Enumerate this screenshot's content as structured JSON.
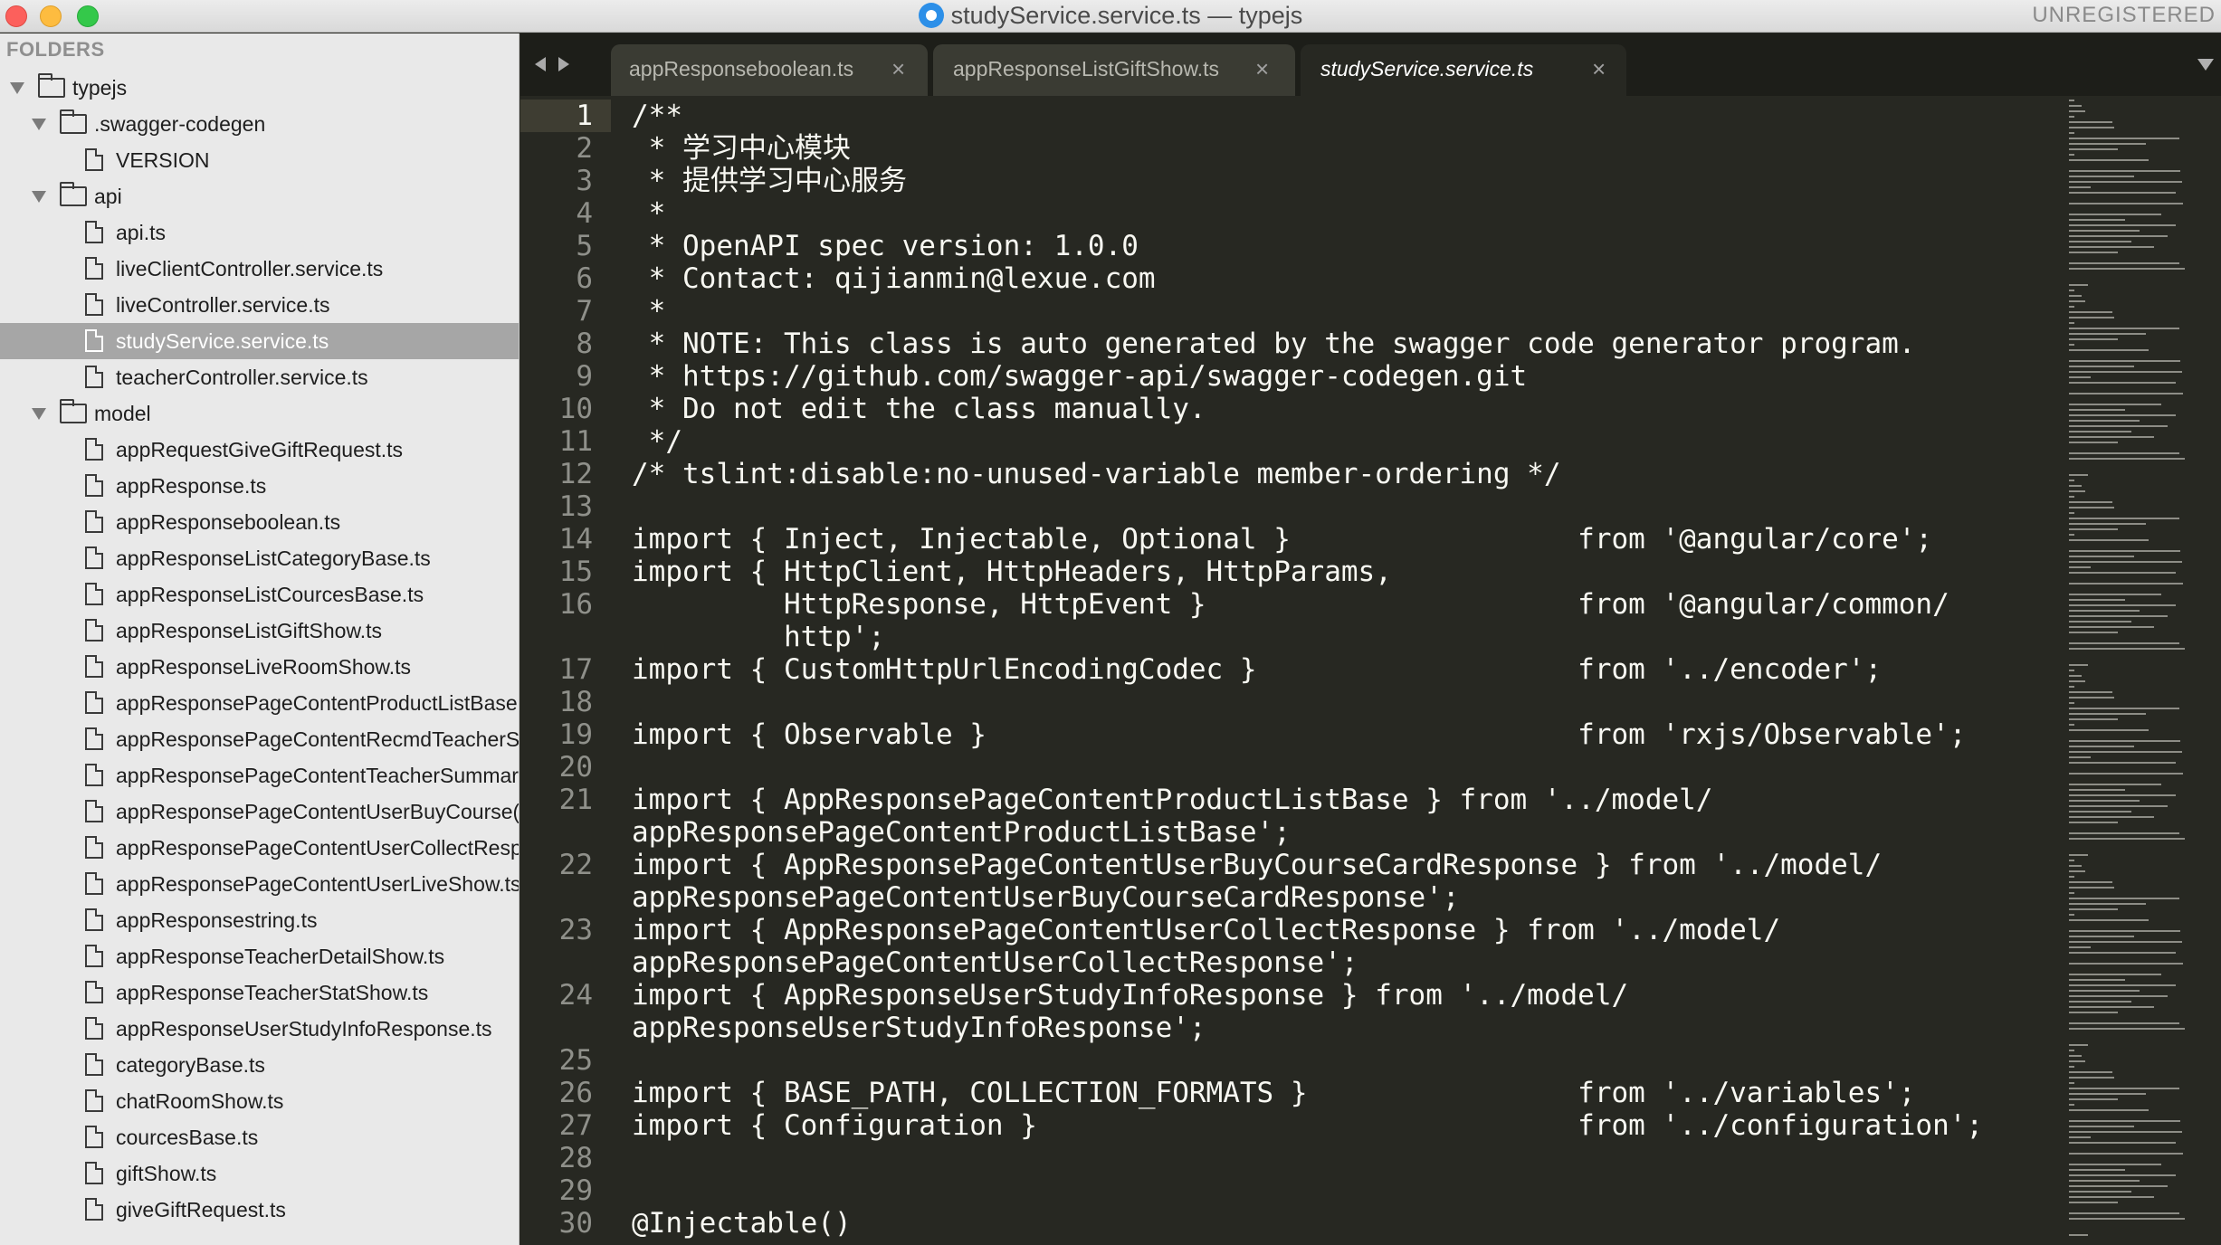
{
  "window": {
    "title": "studyService.service.ts — typejs",
    "unregistered": "UNREGISTERED"
  },
  "sidebar": {
    "header": "FOLDERS",
    "root": "typejs",
    "swagger_folder": ".swagger-codegen",
    "version_file": "VERSION",
    "api_folder": "api",
    "api_files": [
      "api.ts",
      "liveClientController.service.ts",
      "liveController.service.ts",
      "studyService.service.ts",
      "teacherController.service.ts"
    ],
    "model_folder": "model",
    "model_files": [
      "appRequestGiveGiftRequest.ts",
      "appResponse.ts",
      "appResponseboolean.ts",
      "appResponseListCategoryBase.ts",
      "appResponseListCourcesBase.ts",
      "appResponseListGiftShow.ts",
      "appResponseLiveRoomShow.ts",
      "appResponsePageContentProductListBase",
      "appResponsePageContentRecmdTeacherS",
      "appResponsePageContentTeacherSummar",
      "appResponsePageContentUserBuyCourse(",
      "appResponsePageContentUserCollectResp",
      "appResponsePageContentUserLiveShow.ts",
      "appResponsestring.ts",
      "appResponseTeacherDetailShow.ts",
      "appResponseTeacherStatShow.ts",
      "appResponseUserStudyInfoResponse.ts",
      "categoryBase.ts",
      "chatRoomShow.ts",
      "courcesBase.ts",
      "giftShow.ts",
      "giveGiftRequest.ts"
    ]
  },
  "tabs": [
    {
      "label": "appResponseboolean.ts",
      "close": "×"
    },
    {
      "label": "appResponseListGiftShow.ts",
      "close": "×"
    },
    {
      "label": "studyService.service.ts",
      "close": "×"
    }
  ],
  "editor": {
    "current_line": 1,
    "lines": [
      {
        "n": "1",
        "text": "/**"
      },
      {
        "n": "2",
        "text": " * 学习中心模块"
      },
      {
        "n": "3",
        "text": " * 提供学习中心服务"
      },
      {
        "n": "4",
        "text": " *"
      },
      {
        "n": "5",
        "text": " * OpenAPI spec version: 1.0.0"
      },
      {
        "n": "6",
        "text": " * Contact: qijianmin@lexue.com"
      },
      {
        "n": "7",
        "text": " *"
      },
      {
        "n": "8",
        "text": " * NOTE: This class is auto generated by the swagger code generator program."
      },
      {
        "n": "9",
        "text": " * https://github.com/swagger-api/swagger-codegen.git"
      },
      {
        "n": "10",
        "text": " * Do not edit the class manually."
      },
      {
        "n": "11",
        "text": " */"
      },
      {
        "n": "12",
        "text": "/* tslint:disable:no-unused-variable member-ordering */"
      },
      {
        "n": "13",
        "text": ""
      },
      {
        "n": "14",
        "text": "import { Inject, Injectable, Optional }                 from '@angular/core';"
      },
      {
        "n": "15",
        "text": "import { HttpClient, HttpHeaders, HttpParams,"
      },
      {
        "n": "16",
        "text": "         HttpResponse, HttpEvent }                      from '@angular/common/"
      },
      {
        "n": "",
        "text": "         http';"
      },
      {
        "n": "17",
        "text": "import { CustomHttpUrlEncodingCodec }                   from '../encoder';"
      },
      {
        "n": "18",
        "text": ""
      },
      {
        "n": "19",
        "text": "import { Observable }                                   from 'rxjs/Observable';"
      },
      {
        "n": "20",
        "text": ""
      },
      {
        "n": "21",
        "text": "import { AppResponsePageContentProductListBase } from '../model/"
      },
      {
        "n": "",
        "text": "appResponsePageContentProductListBase';"
      },
      {
        "n": "22",
        "text": "import { AppResponsePageContentUserBuyCourseCardResponse } from '../model/"
      },
      {
        "n": "",
        "text": "appResponsePageContentUserBuyCourseCardResponse';"
      },
      {
        "n": "23",
        "text": "import { AppResponsePageContentUserCollectResponse } from '../model/"
      },
      {
        "n": "",
        "text": "appResponsePageContentUserCollectResponse';"
      },
      {
        "n": "24",
        "text": "import { AppResponseUserStudyInfoResponse } from '../model/"
      },
      {
        "n": "",
        "text": "appResponseUserStudyInfoResponse';"
      },
      {
        "n": "25",
        "text": ""
      },
      {
        "n": "26",
        "text": "import { BASE_PATH, COLLECTION_FORMATS }                from '../variables';"
      },
      {
        "n": "27",
        "text": "import { Configuration }                                from '../configuration';"
      },
      {
        "n": "28",
        "text": ""
      },
      {
        "n": "29",
        "text": ""
      },
      {
        "n": "30",
        "text": "@Injectable()"
      }
    ]
  },
  "colors": {
    "editor_bg": "#272822",
    "text": "#f8f8f2",
    "gutter_text": "#8f908a",
    "sidebar_bg": "#e9e9e9",
    "sidebar_selected": "#a6a6a6"
  }
}
